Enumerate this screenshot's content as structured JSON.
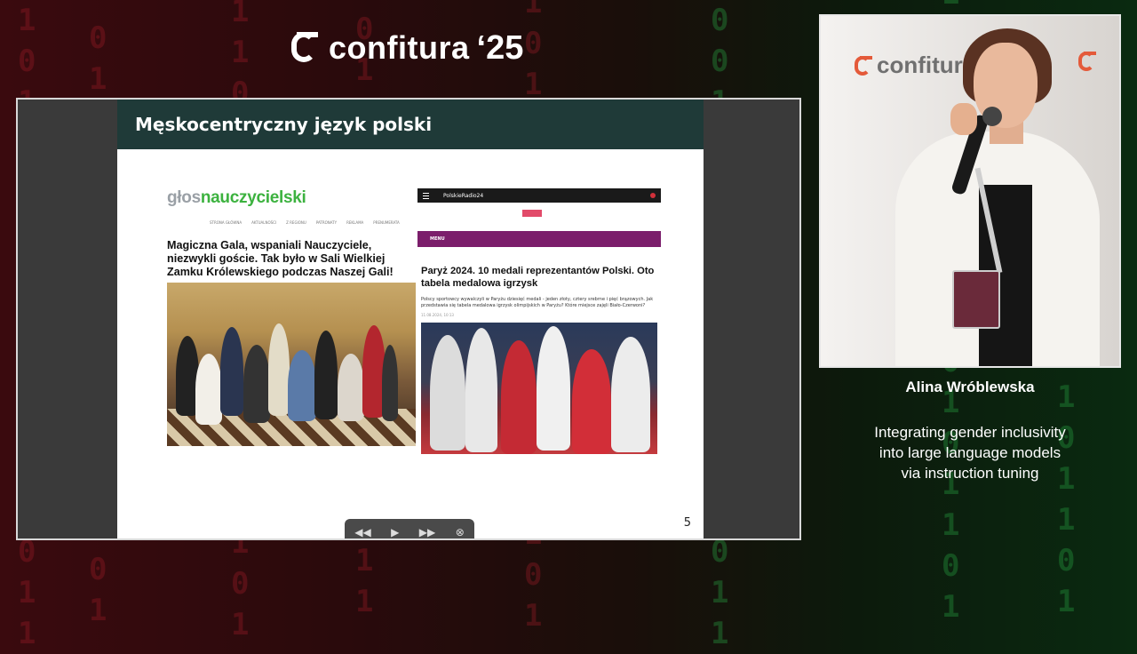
{
  "event": {
    "logo_text": "confitura",
    "logo_year": "‘25"
  },
  "slide": {
    "title": "Męskocentryczny język polski",
    "number": "5",
    "left_article": {
      "site_logo_part1": "głos",
      "site_logo_part2": "nauczycielski",
      "nav": [
        "STRONA GŁÓWNA",
        "AKTUALNOŚCI",
        "Z REGIONU",
        "PATRONATY",
        "REKLAMA",
        "PRENUMERATA"
      ],
      "headline": "Magiczna Gala, wspaniali Nauczyciele, niezwykli goście. Tak było w Sali Wielkiej Zamku Królewskiego podczas Naszej Gali!"
    },
    "right_article": {
      "site_name": "PolskieRadio24",
      "menu_label": "MENU",
      "headline": "Paryż 2024. 10 medali reprezentantów Polski. Oto tabela medalowa igrzysk",
      "lead": "Polscy sportowcy wywalczyli w Paryżu dziesięć medali - jeden złoty, cztery srebrne i pięć brązowych. Jak przedstawia się tabela medalowa igrzysk olimpijskich w Paryżu? Które miejsce zajęli Biało-Czerwoni?",
      "date": "11.08.2024, 10:13"
    }
  },
  "player_controls": {
    "rewind_icon": "rewind-icon",
    "play_icon": "play-icon",
    "forward_icon": "fast-forward-icon",
    "close_icon": "close-circle-icon"
  },
  "speaker": {
    "name": "Alina Wróblewska",
    "talk_title_lines": [
      "Integrating gender inclusivity",
      "into large language models",
      "via instruction tuning"
    ]
  },
  "colors": {
    "slide_header_bg": "#1f3a38",
    "brand_green": "#3cb23f",
    "radio_menu": "#7b1e6b",
    "logo_accent": "#e45a3a"
  }
}
